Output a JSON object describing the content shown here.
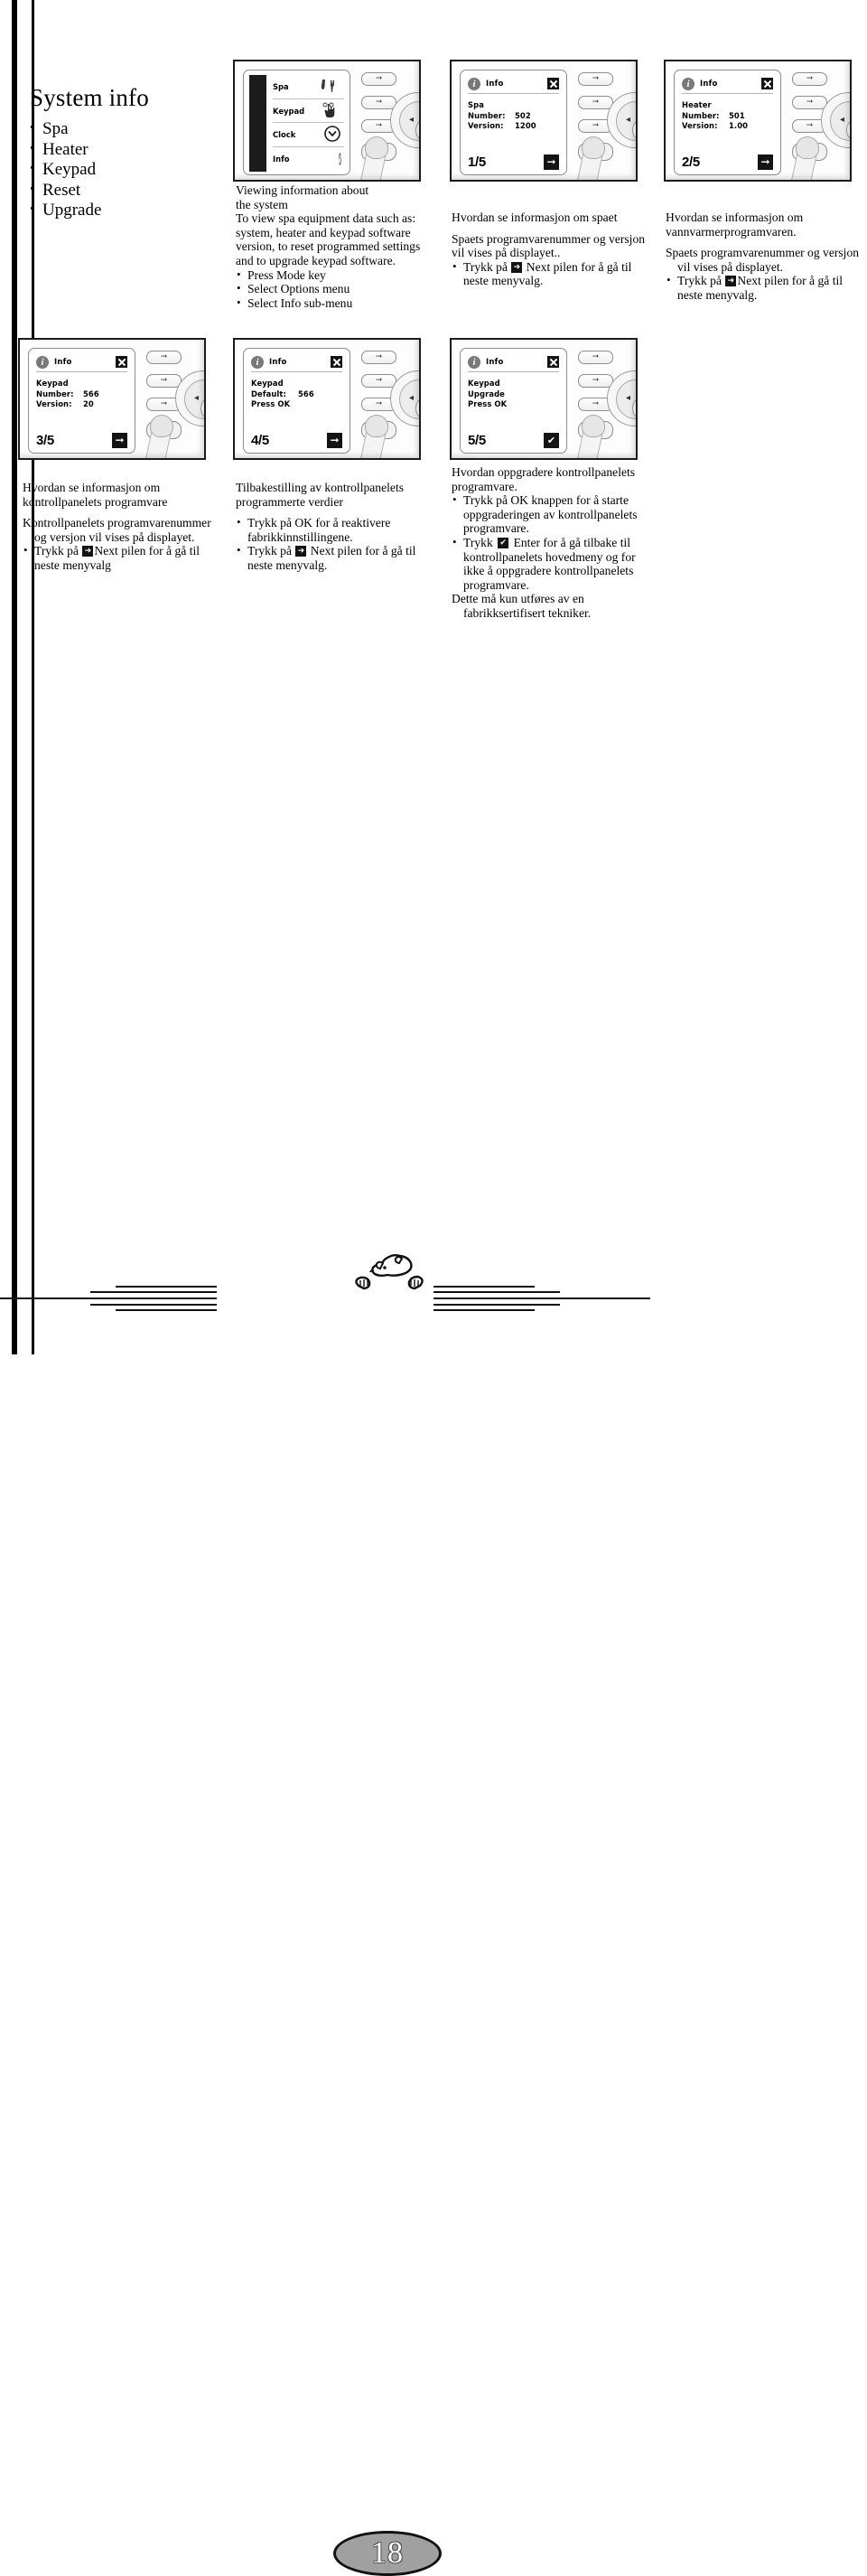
{
  "sidebar": {
    "title": "System info",
    "items": [
      "Spa",
      "Heater",
      "Keypad",
      "Reset",
      "Upgrade"
    ]
  },
  "icons": {
    "info": "info-circle-icon",
    "close": "close-x-icon",
    "next_arrow": "next-arrow-icon",
    "enter_check": "enter-checkmark-icon",
    "softkey_arrow": "right-arrow-icon",
    "nav_left": "left-arrow-icon",
    "spa_tools": "wrench-tools-icon",
    "keypad_hand": "hand-pressing-icon",
    "clock": "clock-icon",
    "finger": "finger-pointing-icon",
    "bear": "polar-bear-logo"
  },
  "screens": [
    {
      "id": "options-menu",
      "type": "menu",
      "header_title": "Info",
      "rows": [
        {
          "label": "Spa",
          "icon": "wrench-tools-icon"
        },
        {
          "label": "Keypad",
          "icon": "hand-pressing-icon"
        },
        {
          "label": "Clock",
          "icon": "clock-icon"
        },
        {
          "label": "Info",
          "icon": "info-circle-icon"
        }
      ]
    },
    {
      "id": "info-1-5",
      "type": "info",
      "header_title": "Info",
      "section": "Spa",
      "fields": [
        {
          "key": "Number:",
          "value": "502"
        },
        {
          "key": "Version:",
          "value": "1200"
        }
      ],
      "page": "1/5",
      "action_icon": "next-arrow-icon"
    },
    {
      "id": "info-2-5",
      "type": "info",
      "header_title": "Info",
      "section": "Heater",
      "fields": [
        {
          "key": "Number:",
          "value": "501"
        },
        {
          "key": "Version:",
          "value": "1.00"
        }
      ],
      "page": "2/5",
      "action_icon": "next-arrow-icon"
    },
    {
      "id": "info-3-5",
      "type": "info",
      "header_title": "Info",
      "section": "Keypad",
      "fields": [
        {
          "key": "Number:",
          "value": "566"
        },
        {
          "key": "Version:",
          "value": "20"
        }
      ],
      "page": "3/5",
      "action_icon": "next-arrow-icon"
    },
    {
      "id": "info-4-5",
      "type": "info",
      "header_title": "Info",
      "section": "Keypad",
      "fields": [
        {
          "key": "Default:",
          "value": "566"
        },
        {
          "key": "Press OK",
          "value": ""
        }
      ],
      "page": "4/5",
      "action_icon": "next-arrow-icon"
    },
    {
      "id": "info-5-5",
      "type": "info",
      "header_title": "Info",
      "section": "Keypad",
      "fields": [
        {
          "key": "Upgrade",
          "value": ""
        },
        {
          "key": "Press OK",
          "value": ""
        }
      ],
      "page": "5/5",
      "action_icon": "enter-checkmark-icon"
    }
  ],
  "captions": {
    "c1": {
      "title_l1": "Viewing information about",
      "title_l2": "the system",
      "body_l1": "To view spa equipment data such as:",
      "body_l2": "system, heater and keypad software",
      "body_l3": "version, to reset programmed settings",
      "body_l4": "and to upgrade keypad software.",
      "b1": "Press Mode key",
      "b2": "Select Options menu",
      "b3": "Select Info sub-menu"
    },
    "c2": {
      "title": "Hvordan se informasjon om spaet",
      "body_l1": "Spaets programvarenummer og versjon",
      "body_l2": "vil vises på displayet..",
      "b1_pre": "Trykk på",
      "b1_post": "Next pilen for å gå til",
      "b1_l2": "neste menyvalg."
    },
    "c3": {
      "title_l1": "Hvordan se informasjon om",
      "title_l2": "vannvarmerprogramvaren.",
      "body_l1": "Spaets programvarenummer og versjon",
      "body_l2": "vil vises på displayet.",
      "b1_pre": "Trykk på",
      "b1_post": "Next pilen for å gå til",
      "b1_l2": "neste menyvalg."
    },
    "c4": {
      "title_l1": "Hvordan se informasjon om",
      "title_l2": "kontrollpanelets programvare",
      "body_l1": "Kontrollpanelets programvarenummer",
      "body_l2": "og versjon vil vises på displayet.",
      "b1_pre": "Trykk på",
      "b1_post": "Next pilen for å gå til",
      "b1_l2": "neste menyvalg"
    },
    "c5": {
      "title_l1": "Tilbakestilling av kontrollpanelets",
      "title_l2": "programmerte verdier",
      "b1_l1": "Trykk på OK for å reaktivere",
      "b1_l2": "fabrikkinnstillingene.",
      "b2_pre": "Trykk på",
      "b2_post": "Next pilen for å gå til",
      "b2_l2": "neste menyvalg."
    },
    "c6": {
      "title_l1": "Hvordan oppgradere kontrollpanelets",
      "title_l2": "programvare.",
      "b1_l1": "Trykk på OK knappen for å starte",
      "b1_l2": "oppgraderingen av kontrollpanelets",
      "b1_l3": "programvare.",
      "b2_pre": "Trykk",
      "b2_post": "Enter for å gå tilbake til",
      "b2_l2": "kontrollpanelets hovedmeny og for",
      "b2_l3": "ikke å oppgradere kontrollpanelets",
      "b2_l4": "programvare.",
      "note_l1": "Dette må kun utføres av en",
      "note_l2": "fabrikksertifisert tekniker."
    }
  },
  "footer": {
    "page_number": "18"
  }
}
